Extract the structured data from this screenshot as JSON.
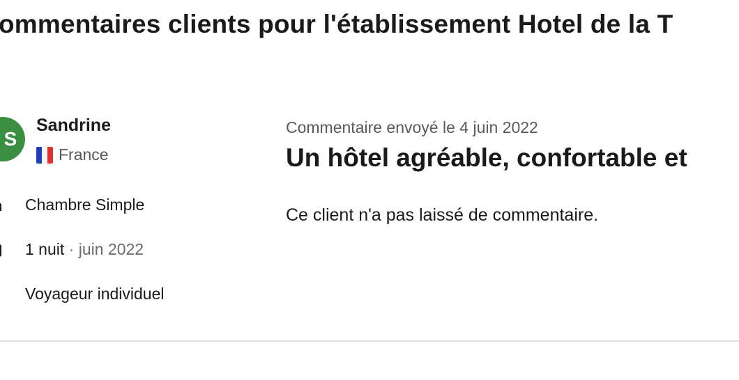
{
  "page": {
    "title": "ommentaires clients pour l'établissement Hotel de la T"
  },
  "reviewer": {
    "initial": "S",
    "name": "Sandrine",
    "country": "France",
    "room": "Chambre Simple",
    "nights": "1 nuit",
    "stay_separator": " · ",
    "stay_date": "juin 2022",
    "traveler_type": "Voyageur individuel"
  },
  "review": {
    "date_text": "Commentaire envoyé le 4 juin 2022",
    "title": "Un hôtel agréable, confortable et",
    "body": "Ce client n'a pas laissé de commentaire."
  },
  "colors": {
    "avatar_bg": "#3b8f42",
    "text_primary": "#1a1a1a",
    "text_secondary": "#595959",
    "divider": "#e2e2e2"
  },
  "icons": {
    "room": "bed-icon",
    "stay": "calendar-icon",
    "flag": "france-flag-icon"
  }
}
